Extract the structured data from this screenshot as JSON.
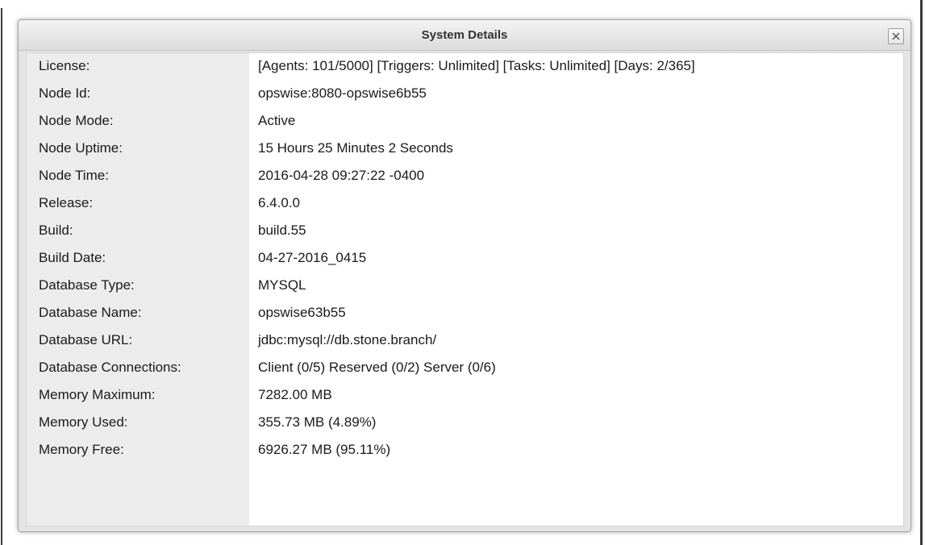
{
  "dialog": {
    "title": "System Details",
    "close_icon": "close-icon"
  },
  "rows": [
    {
      "label": "License:",
      "value": "[Agents: 101/5000] [Triggers: Unlimited] [Tasks: Unlimited] [Days: 2/365]"
    },
    {
      "label": "Node Id:",
      "value": "opswise:8080-opswise6b55"
    },
    {
      "label": "Node Mode:",
      "value": "Active"
    },
    {
      "label": "Node Uptime:",
      "value": "15 Hours 25 Minutes 2 Seconds"
    },
    {
      "label": "Node Time:",
      "value": "2016-04-28 09:27:22 -0400"
    },
    {
      "label": "Release:",
      "value": "6.4.0.0"
    },
    {
      "label": "Build:",
      "value": "build.55"
    },
    {
      "label": "Build Date:",
      "value": "04-27-2016_0415"
    },
    {
      "label": "Database Type:",
      "value": "MYSQL"
    },
    {
      "label": "Database Name:",
      "value": "opswise63b55"
    },
    {
      "label": "Database URL:",
      "value": "jdbc:mysql://db.stone.branch/"
    },
    {
      "label": "Database Connections:",
      "value": "Client (0/5) Reserved (0/2) Server (0/6)"
    },
    {
      "label": "Memory Maximum:",
      "value": "7282.00 MB"
    },
    {
      "label": "Memory Used:",
      "value": "355.73 MB (4.89%)"
    },
    {
      "label": "Memory Free:",
      "value": "6926.27 MB (95.11%)"
    }
  ],
  "colors": {
    "title_text": "#333333",
    "label_column_bg": "#ececec",
    "dialog_bg": "#e4e4e4"
  }
}
